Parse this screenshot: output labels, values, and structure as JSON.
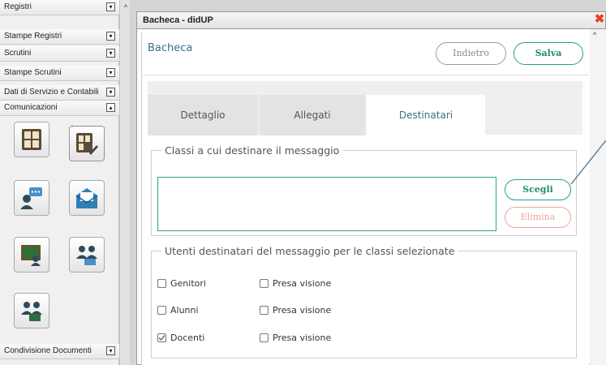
{
  "sidebar": {
    "items": [
      {
        "label": "Registri",
        "toggle": "▾"
      },
      {
        "label": "Stampe Registri",
        "toggle": "▾"
      },
      {
        "label": "Scrutini",
        "toggle": "▾"
      },
      {
        "label": "Stampe Scrutini",
        "toggle": "▾"
      },
      {
        "label": "Dati di Servizio e Contabili",
        "toggle": "▾"
      },
      {
        "label": "Comunicazioni",
        "toggle": "▴"
      }
    ],
    "bottom_item": {
      "label": "Condivisione Documenti",
      "toggle": "▾"
    },
    "tiles": [
      "bacheca-icon",
      "bacheca-edit-icon",
      "user-message-icon",
      "mail-icon",
      "classroom-board-icon",
      "users-group-icon",
      "users-board-icon"
    ]
  },
  "window": {
    "title": "Bacheca - didUP",
    "close": "✖"
  },
  "header": {
    "title": "Bacheca",
    "back_label": "Indietro",
    "save_label": "Salva"
  },
  "tabs": [
    {
      "label": "Dettaglio",
      "active": false
    },
    {
      "label": "Allegati",
      "active": false
    },
    {
      "label": "Destinatari",
      "active": true
    }
  ],
  "classi_section": {
    "legend": "Classi a cui destinare il messaggio",
    "choose_label": "Scegli",
    "remove_label": "Elimina"
  },
  "utenti_section": {
    "legend": "Utenti destinatari del messaggio per le classi selezionate",
    "rows": [
      {
        "label": "Genitori",
        "checked": false,
        "ack_label": "Presa visione",
        "ack_checked": false
      },
      {
        "label": "Alunni",
        "checked": false,
        "ack_label": "Presa visione",
        "ack_checked": false
      },
      {
        "label": "Docenti",
        "checked": true,
        "ack_label": "Presa visione",
        "ack_checked": false
      }
    ]
  },
  "colors": {
    "accent": "#2a9e84",
    "title_blue": "#3b6f8a",
    "close": "#e5431d",
    "danger_light": "#f0a79a"
  }
}
